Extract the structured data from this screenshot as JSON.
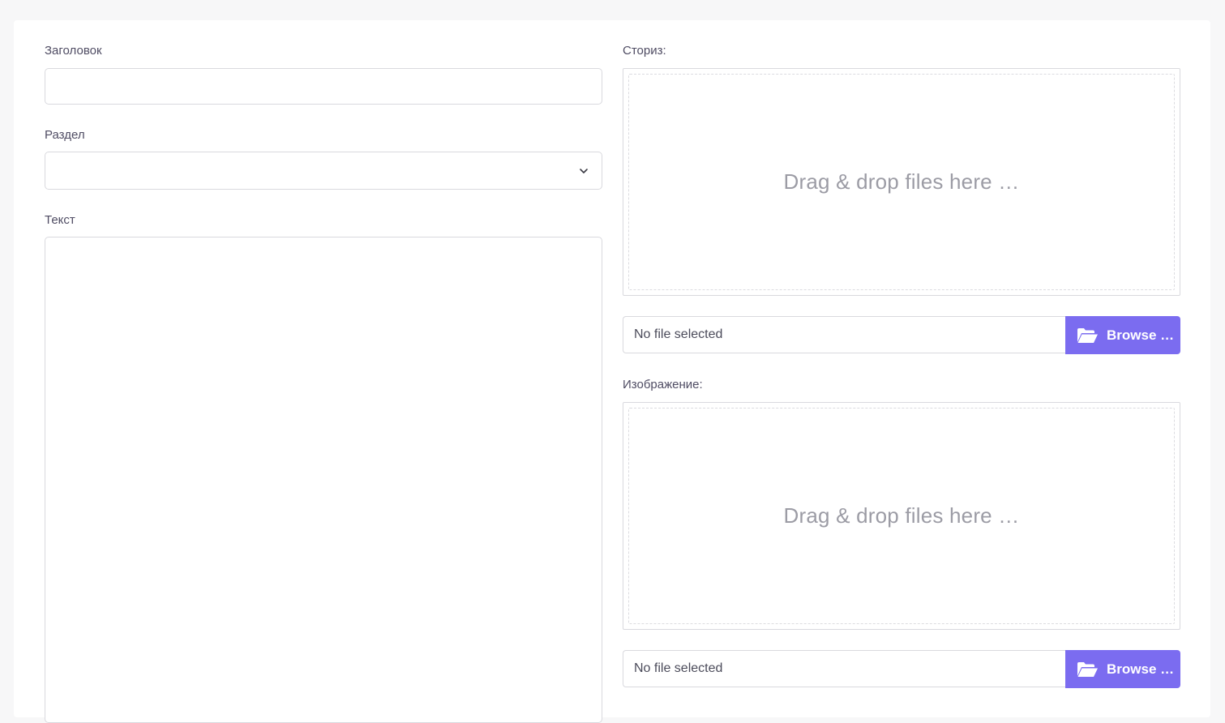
{
  "form": {
    "title_label": "Заголовок",
    "title_value": "",
    "section_label": "Раздел",
    "section_value": "",
    "text_label": "Текст",
    "text_value": ""
  },
  "story_upload": {
    "label": "Сториз:",
    "dropzone_text": "Drag & drop files here …",
    "caption": "No file selected",
    "browse_label": "Browse …"
  },
  "image_upload": {
    "label": "Изображение:",
    "dropzone_text": "Drag & drop files here …",
    "caption": "No file selected",
    "browse_label": "Browse …"
  },
  "icons": {
    "chevron": "chevron-down-icon",
    "folder": "folder-open-icon"
  },
  "colors": {
    "accent": "#7b6cf0",
    "background": "#f7f7f8"
  }
}
